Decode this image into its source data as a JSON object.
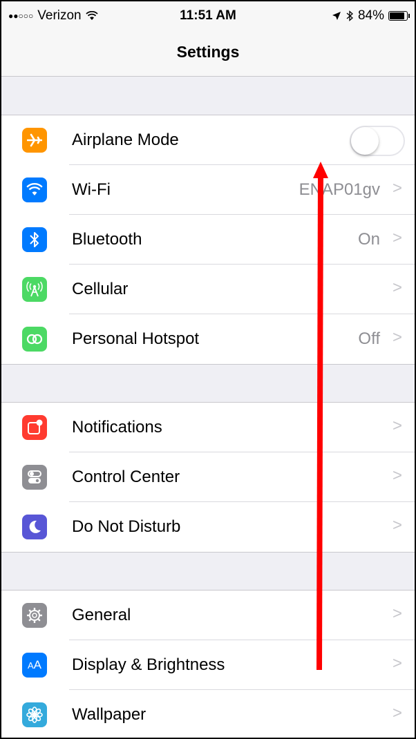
{
  "status_bar": {
    "signal": "●●○○○",
    "carrier": "Verizon",
    "time": "11:51 AM",
    "battery": "84%"
  },
  "nav": {
    "title": "Settings"
  },
  "groups": [
    {
      "items": [
        {
          "label": "Airplane Mode",
          "icon": "airplane-icon",
          "color": "#ff9500",
          "toggle": false
        },
        {
          "label": "Wi-Fi",
          "icon": "wifi-icon",
          "color": "#007aff",
          "value": "ENAP01gv"
        },
        {
          "label": "Bluetooth",
          "icon": "bluetooth-icon",
          "color": "#007aff",
          "value": "On"
        },
        {
          "label": "Cellular",
          "icon": "cellular-icon",
          "color": "#4cd964",
          "value": ""
        },
        {
          "label": "Personal Hotspot",
          "icon": "hotspot-icon",
          "color": "#4cd964",
          "value": "Off"
        }
      ]
    },
    {
      "items": [
        {
          "label": "Notifications",
          "icon": "notifications-icon",
          "color": "#ff3b30"
        },
        {
          "label": "Control Center",
          "icon": "control-center-icon",
          "color": "#8e8e93"
        },
        {
          "label": "Do Not Disturb",
          "icon": "moon-icon",
          "color": "#5856d6"
        }
      ]
    },
    {
      "items": [
        {
          "label": "General",
          "icon": "gear-icon",
          "color": "#8e8e93"
        },
        {
          "label": "Display & Brightness",
          "icon": "display-brightness-icon",
          "color": "#007aff"
        },
        {
          "label": "Wallpaper",
          "icon": "wallpaper-icon",
          "color": "#34aadc"
        }
      ]
    }
  ],
  "annotation": {
    "arrow_color": "#ff0000"
  }
}
